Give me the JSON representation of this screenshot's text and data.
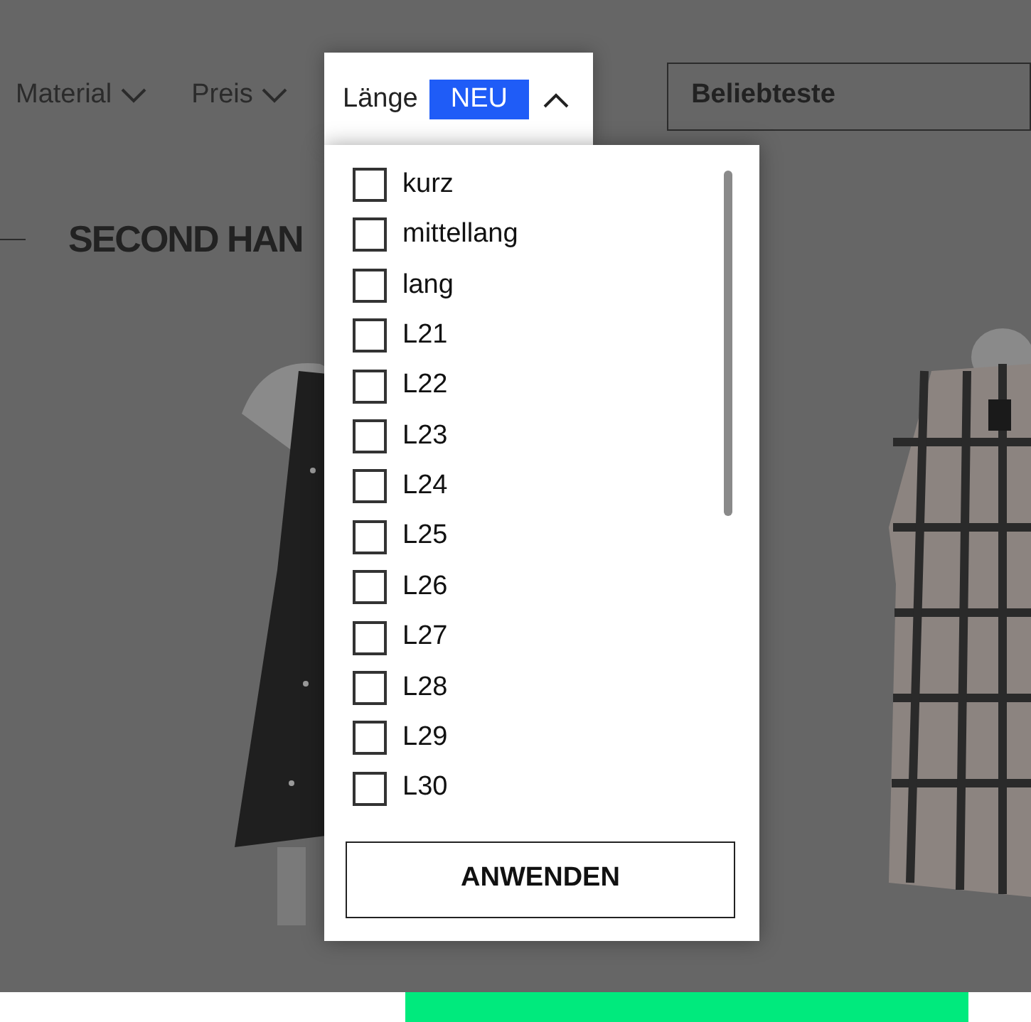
{
  "filters": [
    {
      "label": "Material"
    },
    {
      "label": "Preis"
    }
  ],
  "open_filter": {
    "label": "Länge",
    "badge": "NEU",
    "expanded": true,
    "options": [
      {
        "label": "kurz",
        "checked": false
      },
      {
        "label": "mittellang",
        "checked": false
      },
      {
        "label": "lang",
        "checked": false
      },
      {
        "label": "L21",
        "checked": false
      },
      {
        "label": "L22",
        "checked": false
      },
      {
        "label": "L23",
        "checked": false
      },
      {
        "label": "L24",
        "checked": false
      },
      {
        "label": "L25",
        "checked": false
      },
      {
        "label": "L26",
        "checked": false
      },
      {
        "label": "L27",
        "checked": false
      },
      {
        "label": "L28",
        "checked": false
      },
      {
        "label": "L29",
        "checked": false
      },
      {
        "label": "L30",
        "checked": false
      }
    ],
    "apply_button": "ANWENDEN"
  },
  "sort": {
    "value": "Beliebteste"
  },
  "heading": "SECOND HAN"
}
